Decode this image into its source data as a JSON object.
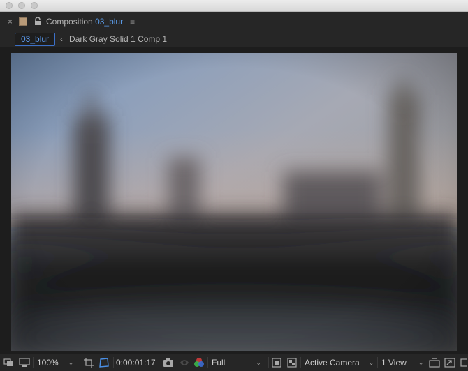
{
  "panel": {
    "close_glyph": "×",
    "label_color": "#b89a78",
    "title_prefix": "Composition",
    "comp_name": "03_blur",
    "menu_glyph": "≡"
  },
  "breadcrumb": {
    "active_tab": "03_blur",
    "chevron": "‹",
    "other_tab": "Dark Gray Solid 1 Comp 1"
  },
  "viewer": {
    "content": "blurred-city-skyline-preview"
  },
  "toolbar": {
    "zoom": "100%",
    "timecode": "0:00:01:17",
    "resolution": "Full",
    "camera": "Active Camera",
    "views": "1 View",
    "dropdown_glyph": "⌄",
    "icons": {
      "always_preview": "always-preview-icon",
      "monitor": "monitor-icon",
      "grid": "grid-guides-icon",
      "mask": "mask-visibility-icon",
      "snapshot": "camera-snapshot-icon",
      "show_snapshot": "show-snapshot-icon",
      "channels": "color-channels-icon",
      "region": "region-of-interest-icon",
      "transparency": "transparency-grid-icon",
      "reset_exposure": "reset-exposure-icon",
      "fast_preview": "fast-preview-icon",
      "timeline": "timeline-icon"
    }
  },
  "colors": {
    "accent": "#5a9ae6"
  }
}
